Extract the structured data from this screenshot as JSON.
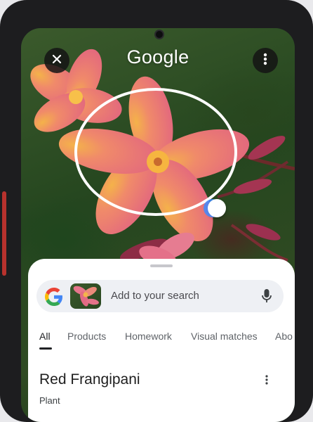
{
  "header": {
    "logo_text": "Google"
  },
  "search": {
    "placeholder": "Add to your search"
  },
  "tabs": [
    {
      "label": "All",
      "active": true
    },
    {
      "label": "Products",
      "active": false
    },
    {
      "label": "Homework",
      "active": false
    },
    {
      "label": "Visual matches",
      "active": false
    },
    {
      "label": "Abo",
      "active": false
    }
  ],
  "result": {
    "title": "Red Frangipani",
    "subtitle": "Plant"
  },
  "colors": {
    "frame": "#1d1d1f",
    "accent_blue": "#4285F4",
    "petal_pink": "#e8708a",
    "petal_center": "#f3a23c"
  },
  "icons": [
    "close-icon",
    "more-vert-icon",
    "google-g-icon",
    "mic-icon"
  ]
}
